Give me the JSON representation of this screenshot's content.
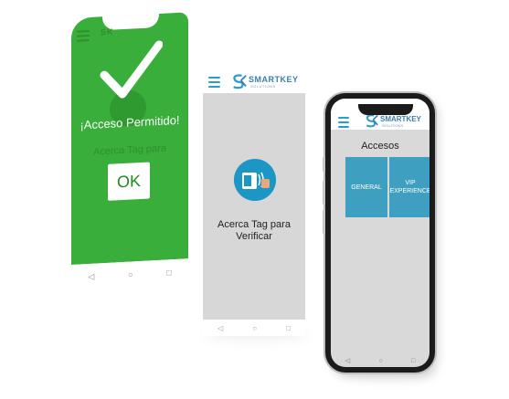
{
  "phone_green": {
    "message": "¡Acceso Permitido!",
    "faded_text": "Acerca Tag para",
    "ok_label": "OK",
    "logo_ghost": "SK",
    "nav": {
      "back": "◁",
      "home": "○",
      "recent": "□"
    }
  },
  "phone_verify": {
    "logo_text": "SMARTKEY",
    "logo_sub": "SOLUTIONS",
    "instruction_line1": "Acerca Tag para",
    "instruction_line2": "Verificar",
    "nav": {
      "back": "◁",
      "home": "○",
      "recent": "□"
    }
  },
  "phone_access": {
    "logo_text": "SMARTKEY",
    "logo_sub": "SOLUTIONS",
    "title": "Accesos",
    "tiles": [
      {
        "label": "GENERAL"
      },
      {
        "label": "VIP EXPERIENCE"
      }
    ],
    "nav": {
      "back": "◁",
      "home": "○",
      "recent": "□"
    }
  },
  "colors": {
    "green": "#3aae3a",
    "brand_blue": "#2a9bd0",
    "tile_blue": "#3f9fc0",
    "screen_grey": "#d7d7d7"
  }
}
